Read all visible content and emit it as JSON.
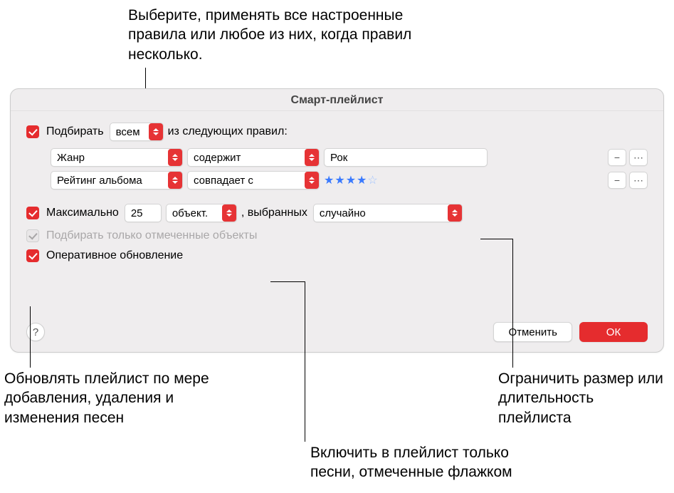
{
  "annotations": {
    "top": "Выберите, применять все настроенные правила или любое из них, когда правил несколько.",
    "bottom_left": "Обновлять плейлист по мере добавления, удаления и изменения песен",
    "bottom_middle": "Включить в плейлист только песни, отмеченные флажком",
    "bottom_right": "Ограничить размер или длительность плейлиста"
  },
  "window_title": "Смарт-плейлист",
  "match": {
    "prefix_label": "Подбирать",
    "mode": "всем",
    "suffix_label": "из следующих правил:"
  },
  "rules": [
    {
      "field": "Жанр",
      "op": "содержит",
      "value": "Рок"
    },
    {
      "field": "Рейтинг альбома",
      "op": "совпадает с",
      "stars": 4,
      "stars_max": 5
    }
  ],
  "limit": {
    "label": "Максимально",
    "value": "25",
    "unit": "объект.",
    "sep": ", выбранных",
    "method": "случайно"
  },
  "checked_only_label": "Подбирать только отмеченные объекты",
  "live_update_label": "Оперативное обновление",
  "buttons": {
    "cancel": "Отменить",
    "ok": "ОК"
  },
  "icons": {
    "minus": "−",
    "more": "⋯",
    "help": "?"
  }
}
